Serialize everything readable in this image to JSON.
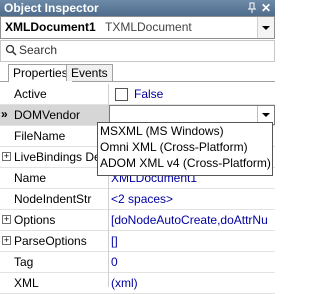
{
  "panel": {
    "title": "Object Inspector",
    "close_glyph": "✕"
  },
  "object_selector": {
    "name": "XMLDocument1",
    "type": "TXMLDocument"
  },
  "search": {
    "placeholder": "Search"
  },
  "tabs": [
    {
      "label": "Properties",
      "active": true
    },
    {
      "label": "Events",
      "active": false
    }
  ],
  "properties": [
    {
      "name": "Active",
      "value": "False",
      "kind": "checkbox",
      "checked": false
    },
    {
      "name": "DOMVendor",
      "value": "",
      "kind": "combo",
      "selected": true
    },
    {
      "name": "FileName",
      "value": ""
    },
    {
      "name": "LiveBindings De",
      "value": "",
      "expandable": true
    },
    {
      "name": "Name",
      "value": "XMLDocument1"
    },
    {
      "name": "NodeIndentStr",
      "value": "<2 spaces>"
    },
    {
      "name": "Options",
      "value": "[doNodeAutoCreate,doAttrNu",
      "expandable": true
    },
    {
      "name": "ParseOptions",
      "value": "[]",
      "expandable": true
    },
    {
      "name": "Tag",
      "value": "0"
    },
    {
      "name": "XML",
      "value": "(xml)"
    }
  ],
  "dropdown_options": [
    "MSXML (MS Windows)",
    "Omni XML (Cross-Platform)",
    "ADOM XML v4 (Cross-Platform)"
  ],
  "selected_marker": "»",
  "icons": [
    "pin-icon",
    "close-icon",
    "search-icon",
    "chevron-down-icon",
    "expand-plus-icon"
  ]
}
